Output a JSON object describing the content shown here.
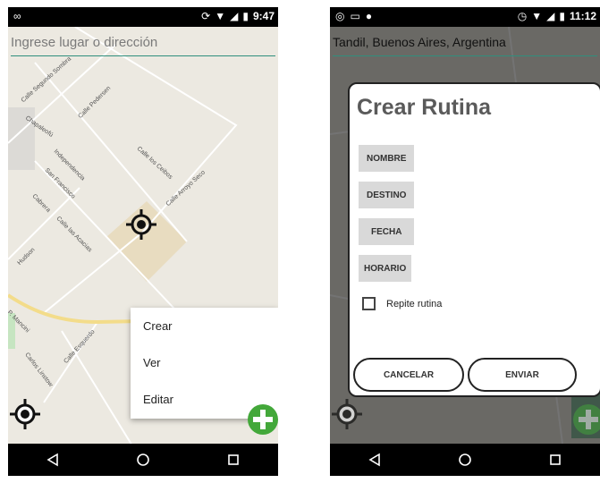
{
  "left_screen": {
    "status_bar": {
      "left_glyph": "∞",
      "time": "9:47"
    },
    "search": {
      "placeholder": "Ingrese lugar o dirección"
    },
    "streets": [
      "Calle Segundo Sombra",
      "Chapaleofú",
      "Calle Pedersen",
      "Calle los Ceibos",
      "Independencia",
      "San Francisco",
      "Cabrera",
      "Calle Arroyo Seco",
      "Calle las Acacias",
      "Hudson",
      "P. Mancini",
      "Carlos Linstow",
      "Calle Esquerdo"
    ],
    "context_menu": {
      "items": [
        "Crear",
        "Ver",
        "Editar"
      ]
    }
  },
  "right_screen": {
    "status_bar": {
      "time": "11:12"
    },
    "search": {
      "value": "Tandil, Buenos Aires, Argentina"
    },
    "dialog": {
      "title": "Crear Rutina",
      "fields": [
        "NOMBRE",
        "DESTINO",
        "FECHA",
        "HORARIO"
      ],
      "checkbox_label": "Repite rutina",
      "cancel_label": "CANCELAR",
      "submit_label": "ENVIAR"
    }
  },
  "colors": {
    "map_bg": "#ece9e1",
    "accent": "#2f8f7d",
    "fab": "#43a83a",
    "road": "#f3dc8a"
  },
  "icons": [
    "location-target-icon",
    "add-icon",
    "back-icon",
    "home-icon",
    "recents-icon"
  ]
}
